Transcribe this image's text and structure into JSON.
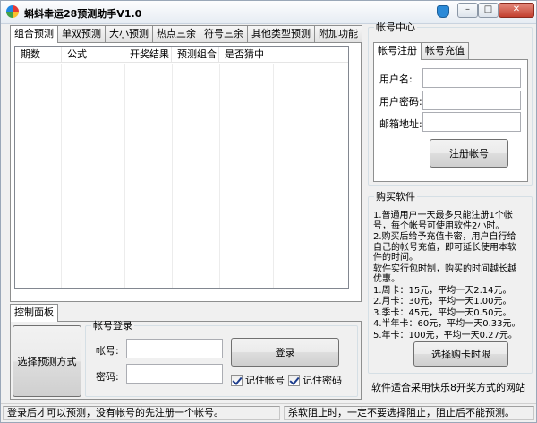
{
  "window": {
    "title": "蝌蚪幸运28预测助手V1.0",
    "controls": {
      "minimize": "–",
      "maximize": "□",
      "close": "✕"
    }
  },
  "main_tabs": [
    {
      "label": "组合预测",
      "active": true
    },
    {
      "label": "单双预测",
      "active": false
    },
    {
      "label": "大小预测",
      "active": false
    },
    {
      "label": "热点三余",
      "active": false
    },
    {
      "label": "符号三余",
      "active": false
    },
    {
      "label": "其他类型预测",
      "active": false
    },
    {
      "label": "附加功能",
      "active": false
    }
  ],
  "prediction_table": {
    "columns": [
      "期数",
      "公式",
      "开奖结果",
      "预测组合",
      "是否猜中"
    ],
    "rows": []
  },
  "control_panel": {
    "tab_label": "控制面板",
    "select_mode_button": "选择预测方式",
    "login_group": {
      "legend": "帐号登录",
      "account_label": "帐号:",
      "account_value": "",
      "password_label": "密码:",
      "password_value": "",
      "login_button": "登录",
      "remember_account": {
        "label": "记住帐号",
        "checked": true
      },
      "remember_password": {
        "label": "记住密码",
        "checked": true
      }
    }
  },
  "account_center": {
    "legend": "帐号中心",
    "tabs": [
      {
        "label": "帐号注册",
        "active": true
      },
      {
        "label": "帐号充值",
        "active": false
      }
    ],
    "username_label": "用户名:",
    "username_value": "",
    "password_label": "用户密码:",
    "password_value": "",
    "email_label": "邮箱地址:",
    "email_value": "",
    "register_button": "注册帐号"
  },
  "purchase": {
    "legend": "购买软件",
    "lines": [
      "1.普通用户一天最多只能注册1个帐号，每个帐号可使用软件2小时。",
      "2.购买后给予充值卡密，用户自行给自己的帐号充值，即可延长使用本软件的时间。",
      "软件实行包时制，购买的时间越长越优惠。",
      "1.周卡：15元，平均一天2.14元。",
      "2.月卡：30元，平均一天1.00元。",
      "3.季卡：45元，平均一天0.50元。",
      "4.半年卡：60元，平均一天0.33元。",
      "5.年卡：100元，平均一天0.27元。"
    ],
    "buy_button": "选择购卡时限"
  },
  "info_note": "软件适合采用快乐8开奖方式的网站",
  "statusbar": {
    "left": "登录后才可以预测，没有帐号的先注册一个帐号。",
    "right": "杀软阻止时，一定不要选择阻止，阻止后不能预测。"
  }
}
